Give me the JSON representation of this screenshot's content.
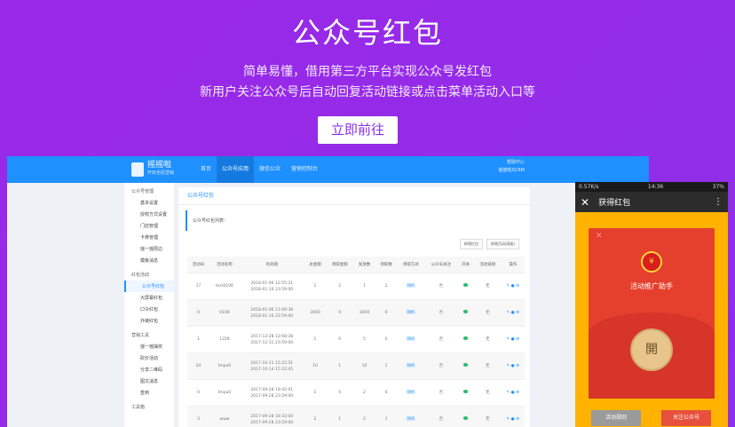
{
  "hero": {
    "title": "公众号红包",
    "subtitle_1": "简单易懂，借用第三方平台实现公众号发红包",
    "subtitle_2": "新用户关注公众号后自动回复活动链接或点击菜单活动入口等",
    "cta_label": "立即前往"
  },
  "admin": {
    "logo": "摇摇啦",
    "logo_sub": "开启全民营销",
    "nav": [
      "首页",
      "公众号应用",
      "微信公众",
      "营销控制台"
    ],
    "top_right_1": "帮助中心",
    "top_right_2": "摇摇啦SCRM",
    "sidebar": [
      {
        "group": "公众号管理",
        "items": [
          "基本设置",
          "授权方式设置",
          "门店管理",
          "卡券管理",
          "摇一摇周边",
          "模板消息"
        ]
      },
      {
        "group": "红包活动",
        "items": [
          "公众号红包",
          "大屏幕红包",
          "口令红包",
          "外链红包"
        ]
      },
      {
        "group": "营销工具",
        "items": [
          "摇一摇抽奖",
          "砍价活动",
          "分享二维码",
          "图文消息",
          "签到"
        ]
      },
      {
        "group": "工具箱",
        "items": []
      }
    ],
    "panel_title": "公众号红包",
    "panel_label": "公众号红包列表：",
    "buttons": [
      "新增红包",
      "新增活动(高级)"
    ],
    "columns": [
      "活动ID",
      "活动名称",
      "有效期",
      "总金额",
      "领取金额",
      "发放数",
      "领取数",
      "领取方式",
      "公众号关注",
      "开关",
      "活动链接",
      "操作"
    ],
    "rows": [
      {
        "id": "17",
        "name": "test0106",
        "start": "2018-01-06 12:55:21",
        "end": "2018-01-10 23:59:00",
        "total": "1",
        "received": "2",
        "issued": "1",
        "claimed": "2",
        "mode": "随机",
        "follow": "否",
        "link": "无"
      },
      {
        "id": "0",
        "name": "0106",
        "start": "2018-01-06 11:09:38",
        "end": "2018-01-10 23:59:00",
        "total": "3000",
        "received": "0",
        "issued": "3000",
        "claimed": "0",
        "mode": "随机",
        "follow": "否",
        "link": "无"
      },
      {
        "id": "1",
        "name": "1228",
        "start": "2017-12-28 12:08:28",
        "end": "2017-12-31 23:59:00",
        "total": "1",
        "received": "0",
        "issued": "5",
        "claimed": "0",
        "mode": "随机",
        "follow": "否",
        "link": "无"
      },
      {
        "id": "24",
        "name": "tmpa0",
        "start": "2017-10-11 15:22:51",
        "end": "2017-10-14 15:22:45",
        "total": "10",
        "received": "1",
        "issued": "10",
        "claimed": "1",
        "mode": "随机",
        "follow": "否",
        "link": "无"
      },
      {
        "id": "0",
        "name": "tmpa0",
        "start": "2017-09-28 18:42:01",
        "end": "2017-09-28 23:59:00",
        "total": "1",
        "received": "0",
        "issued": "2",
        "claimed": "0",
        "mode": "随机",
        "follow": "否",
        "link": "无"
      },
      {
        "id": "3",
        "name": "www",
        "start": "2017-09-28 18:33:04",
        "end": "2017-09-28 23:59:00",
        "total": "2",
        "received": "1",
        "issued": "2",
        "claimed": "1",
        "mode": "随机",
        "follow": "否",
        "link": "无"
      }
    ]
  },
  "phone": {
    "status_left": "0.57K/s",
    "status_time": "14:36",
    "status_battery": "37%",
    "title": "获得红包",
    "sender_badge": "¥",
    "sender": "活动推广助手",
    "open_label": "開",
    "btn_rules": "活动规则",
    "btn_follow": "关注公众号"
  },
  "colors": {
    "background": "#9a28e8",
    "admin_nav": "#1e90ff",
    "envelope": "#e5402d",
    "phone_bg": "#ffb300"
  }
}
